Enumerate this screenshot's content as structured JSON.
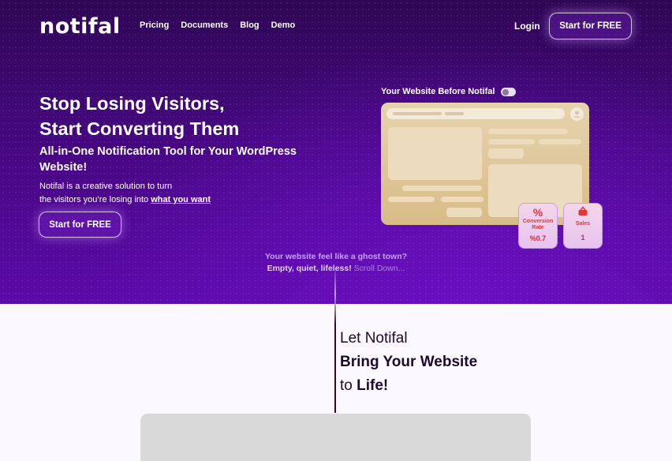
{
  "brand": {
    "logo": "notifal"
  },
  "nav": {
    "items": [
      "Pricing",
      "Documents",
      "Blog",
      "Demo"
    ],
    "login": "Login",
    "cta": "Start for FREE"
  },
  "hero": {
    "title_line1": "Stop Losing Visitors,",
    "title_line2": "Start Converting Them",
    "subtitle": "All-in-One Notification Tool for Your WordPress Website!",
    "desc_line1": "Notifal is a creative solution to turn",
    "desc_line2_prefix": "the visitors you’re losing into ",
    "desc_line2_emphasis": "what you want",
    "cta": "Start for FREE"
  },
  "preview": {
    "toggle_label": "Your Website Before Notifal",
    "toggle_on": false,
    "stats": [
      {
        "icon": "percent-icon",
        "label": "Conversion Rate",
        "value": "%0.7"
      },
      {
        "icon": "basket-icon",
        "label": "Sales",
        "value": "1"
      }
    ]
  },
  "ghost": {
    "line1": "Your website feel like a ghost town?",
    "line2_bold": "Empty, quiet, lifeless!",
    "line2_rest": " Scroll Down..."
  },
  "lower": {
    "line1": "Let Notifal",
    "line2": "Bring Your Website",
    "line3_prefix": "to ",
    "line3_bold": "Life!"
  },
  "colors": {
    "brand_purple": "#45087f",
    "accent_red": "#e0373a",
    "beige": "#e6d3ae"
  }
}
